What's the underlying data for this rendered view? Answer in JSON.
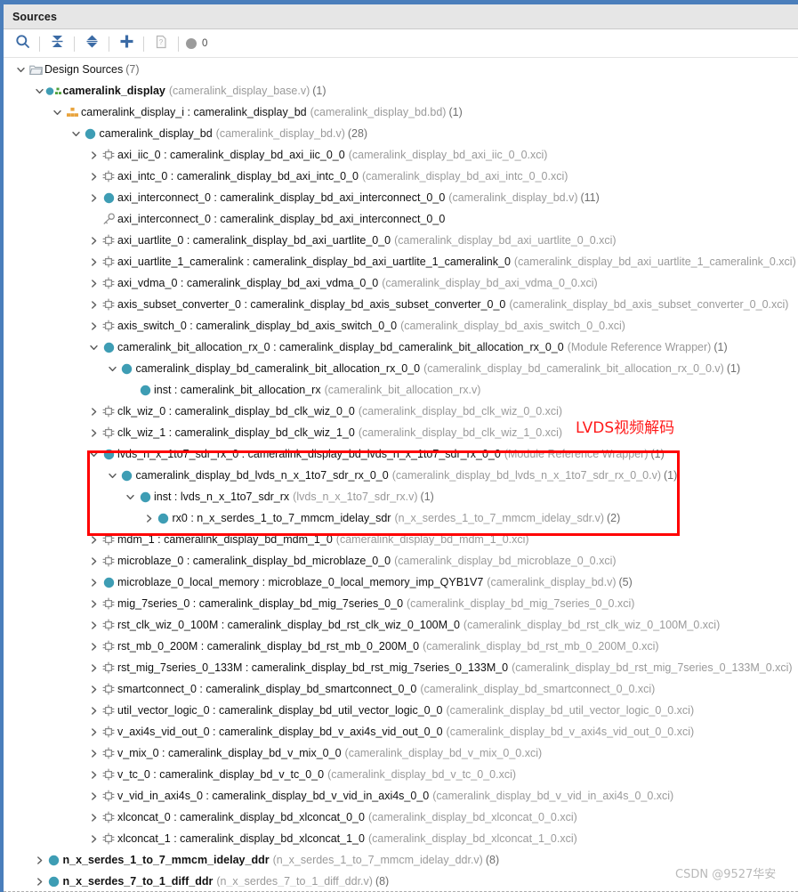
{
  "panel": {
    "title": "Sources"
  },
  "toolbar": {
    "search_tip": "Search",
    "collapse_tip": "Collapse All",
    "expand_tip": "Expand All",
    "add_tip": "Add Sources",
    "report_tip": "Report",
    "count": "0"
  },
  "annotations": {
    "red_note": "LVDS视频解码",
    "watermark": "CSDN @9527华安"
  },
  "tree": [
    {
      "indent": 0,
      "twisty": "down",
      "icon": "folder-icon",
      "name": "Design Sources",
      "bold": false,
      "meta": "",
      "count": "(7)"
    },
    {
      "indent": 1,
      "twisty": "down",
      "icon": "module-green-icon",
      "name": "cameralink_display",
      "bold": true,
      "meta": "(cameralink_display_base.v)",
      "count": "(1)"
    },
    {
      "indent": 2,
      "twisty": "down",
      "icon": "bd-orange-icon",
      "name": "cameralink_display_i : cameralink_display_bd",
      "bold": false,
      "meta": "(cameralink_display_bd.bd)",
      "count": "(1)"
    },
    {
      "indent": 3,
      "twisty": "down",
      "icon": "teal-dot-icon",
      "name": "cameralink_display_bd",
      "bold": false,
      "meta": "(cameralink_display_bd.v)",
      "count": "(28)"
    },
    {
      "indent": 4,
      "twisty": "right",
      "icon": "ip-core-icon",
      "name": "axi_iic_0 : cameralink_display_bd_axi_iic_0_0",
      "bold": false,
      "meta": "(cameralink_display_bd_axi_iic_0_0.xci)",
      "count": ""
    },
    {
      "indent": 4,
      "twisty": "right",
      "icon": "ip-core-icon",
      "name": "axi_intc_0 : cameralink_display_bd_axi_intc_0_0",
      "bold": false,
      "meta": "(cameralink_display_bd_axi_intc_0_0.xci)",
      "count": ""
    },
    {
      "indent": 4,
      "twisty": "right",
      "icon": "teal-dot-icon",
      "name": "axi_interconnect_0 : cameralink_display_bd_axi_interconnect_0_0",
      "bold": false,
      "meta": "(cameralink_display_bd.v)",
      "count": "(11)"
    },
    {
      "indent": 4,
      "twisty": "none",
      "icon": "key-icon",
      "name": "axi_interconnect_0 : cameralink_display_bd_axi_interconnect_0_0",
      "bold": false,
      "meta": "",
      "count": ""
    },
    {
      "indent": 4,
      "twisty": "right",
      "icon": "ip-core-icon",
      "name": "axi_uartlite_0 : cameralink_display_bd_axi_uartlite_0_0",
      "bold": false,
      "meta": "(cameralink_display_bd_axi_uartlite_0_0.xci)",
      "count": ""
    },
    {
      "indent": 4,
      "twisty": "right",
      "icon": "ip-core-icon",
      "name": "axi_uartlite_1_cameralink : cameralink_display_bd_axi_uartlite_1_cameralink_0",
      "bold": false,
      "meta": "(cameralink_display_bd_axi_uartlite_1_cameralink_0.xci)",
      "count": ""
    },
    {
      "indent": 4,
      "twisty": "right",
      "icon": "ip-core-icon",
      "name": "axi_vdma_0 : cameralink_display_bd_axi_vdma_0_0",
      "bold": false,
      "meta": "(cameralink_display_bd_axi_vdma_0_0.xci)",
      "count": ""
    },
    {
      "indent": 4,
      "twisty": "right",
      "icon": "ip-core-icon",
      "name": "axis_subset_converter_0 : cameralink_display_bd_axis_subset_converter_0_0",
      "bold": false,
      "meta": "(cameralink_display_bd_axis_subset_converter_0_0.xci)",
      "count": ""
    },
    {
      "indent": 4,
      "twisty": "right",
      "icon": "ip-core-icon",
      "name": "axis_switch_0 : cameralink_display_bd_axis_switch_0_0",
      "bold": false,
      "meta": "(cameralink_display_bd_axis_switch_0_0.xci)",
      "count": ""
    },
    {
      "indent": 4,
      "twisty": "down",
      "icon": "teal-dot-icon",
      "name": "cameralink_bit_allocation_rx_0 : cameralink_display_bd_cameralink_bit_allocation_rx_0_0",
      "bold": false,
      "meta": "(Module Reference Wrapper)",
      "count": "(1)"
    },
    {
      "indent": 5,
      "twisty": "down",
      "icon": "teal-dot-icon",
      "name": "cameralink_display_bd_cameralink_bit_allocation_rx_0_0",
      "bold": false,
      "meta": "(cameralink_display_bd_cameralink_bit_allocation_rx_0_0.v)",
      "count": "(1)"
    },
    {
      "indent": 6,
      "twisty": "none",
      "icon": "teal-dot-icon",
      "name": "inst : cameralink_bit_allocation_rx",
      "bold": false,
      "meta": "(cameralink_bit_allocation_rx.v)",
      "count": ""
    },
    {
      "indent": 4,
      "twisty": "right",
      "icon": "ip-core-icon",
      "name": "clk_wiz_0 : cameralink_display_bd_clk_wiz_0_0",
      "bold": false,
      "meta": "(cameralink_display_bd_clk_wiz_0_0.xci)",
      "count": ""
    },
    {
      "indent": 4,
      "twisty": "right",
      "icon": "ip-core-icon",
      "name": "clk_wiz_1 : cameralink_display_bd_clk_wiz_1_0",
      "bold": false,
      "meta": "(cameralink_display_bd_clk_wiz_1_0.xci)",
      "count": ""
    },
    {
      "indent": 4,
      "twisty": "down",
      "icon": "teal-dot-icon",
      "name": "lvds_n_x_1to7_sdr_rx_0 : cameralink_display_bd_lvds_n_x_1to7_sdr_rx_0_0",
      "bold": false,
      "meta": "(Module Reference Wrapper)",
      "count": "(1)"
    },
    {
      "indent": 5,
      "twisty": "down",
      "icon": "teal-dot-icon",
      "name": "cameralink_display_bd_lvds_n_x_1to7_sdr_rx_0_0",
      "bold": false,
      "meta": "(cameralink_display_bd_lvds_n_x_1to7_sdr_rx_0_0.v)",
      "count": "(1)"
    },
    {
      "indent": 6,
      "twisty": "down",
      "icon": "teal-dot-icon",
      "name": "inst : lvds_n_x_1to7_sdr_rx",
      "bold": false,
      "meta": "(lvds_n_x_1to7_sdr_rx.v)",
      "count": "(1)"
    },
    {
      "indent": 7,
      "twisty": "right",
      "icon": "teal-dot-icon",
      "name": "rx0 : n_x_serdes_1_to_7_mmcm_idelay_sdr",
      "bold": false,
      "meta": "(n_x_serdes_1_to_7_mmcm_idelay_sdr.v)",
      "count": "(2)"
    },
    {
      "indent": 4,
      "twisty": "right",
      "icon": "ip-core-icon",
      "name": "mdm_1 : cameralink_display_bd_mdm_1_0",
      "bold": false,
      "meta": "(cameralink_display_bd_mdm_1_0.xci)",
      "count": ""
    },
    {
      "indent": 4,
      "twisty": "right",
      "icon": "ip-core-icon",
      "name": "microblaze_0 : cameralink_display_bd_microblaze_0_0",
      "bold": false,
      "meta": "(cameralink_display_bd_microblaze_0_0.xci)",
      "count": ""
    },
    {
      "indent": 4,
      "twisty": "right",
      "icon": "teal-dot-icon",
      "name": "microblaze_0_local_memory : microblaze_0_local_memory_imp_QYB1V7",
      "bold": false,
      "meta": "(cameralink_display_bd.v)",
      "count": "(5)"
    },
    {
      "indent": 4,
      "twisty": "right",
      "icon": "ip-core-icon",
      "name": "mig_7series_0 : cameralink_display_bd_mig_7series_0_0",
      "bold": false,
      "meta": "(cameralink_display_bd_mig_7series_0_0.xci)",
      "count": ""
    },
    {
      "indent": 4,
      "twisty": "right",
      "icon": "ip-core-icon",
      "name": "rst_clk_wiz_0_100M : cameralink_display_bd_rst_clk_wiz_0_100M_0",
      "bold": false,
      "meta": "(cameralink_display_bd_rst_clk_wiz_0_100M_0.xci)",
      "count": ""
    },
    {
      "indent": 4,
      "twisty": "right",
      "icon": "ip-core-icon",
      "name": "rst_mb_0_200M : cameralink_display_bd_rst_mb_0_200M_0",
      "bold": false,
      "meta": "(cameralink_display_bd_rst_mb_0_200M_0.xci)",
      "count": ""
    },
    {
      "indent": 4,
      "twisty": "right",
      "icon": "ip-core-icon",
      "name": "rst_mig_7series_0_133M : cameralink_display_bd_rst_mig_7series_0_133M_0",
      "bold": false,
      "meta": "(cameralink_display_bd_rst_mig_7series_0_133M_0.xci)",
      "count": ""
    },
    {
      "indent": 4,
      "twisty": "right",
      "icon": "ip-core-icon",
      "name": "smartconnect_0 : cameralink_display_bd_smartconnect_0_0",
      "bold": false,
      "meta": "(cameralink_display_bd_smartconnect_0_0.xci)",
      "count": ""
    },
    {
      "indent": 4,
      "twisty": "right",
      "icon": "ip-core-icon",
      "name": "util_vector_logic_0 : cameralink_display_bd_util_vector_logic_0_0",
      "bold": false,
      "meta": "(cameralink_display_bd_util_vector_logic_0_0.xci)",
      "count": ""
    },
    {
      "indent": 4,
      "twisty": "right",
      "icon": "ip-core-icon",
      "name": "v_axi4s_vid_out_0 : cameralink_display_bd_v_axi4s_vid_out_0_0",
      "bold": false,
      "meta": "(cameralink_display_bd_v_axi4s_vid_out_0_0.xci)",
      "count": ""
    },
    {
      "indent": 4,
      "twisty": "right",
      "icon": "ip-core-icon",
      "name": "v_mix_0 : cameralink_display_bd_v_mix_0_0",
      "bold": false,
      "meta": "(cameralink_display_bd_v_mix_0_0.xci)",
      "count": ""
    },
    {
      "indent": 4,
      "twisty": "right",
      "icon": "ip-core-icon",
      "name": "v_tc_0 : cameralink_display_bd_v_tc_0_0",
      "bold": false,
      "meta": "(cameralink_display_bd_v_tc_0_0.xci)",
      "count": ""
    },
    {
      "indent": 4,
      "twisty": "right",
      "icon": "ip-core-icon",
      "name": "v_vid_in_axi4s_0 : cameralink_display_bd_v_vid_in_axi4s_0_0",
      "bold": false,
      "meta": "(cameralink_display_bd_v_vid_in_axi4s_0_0.xci)",
      "count": ""
    },
    {
      "indent": 4,
      "twisty": "right",
      "icon": "ip-core-icon",
      "name": "xlconcat_0 : cameralink_display_bd_xlconcat_0_0",
      "bold": false,
      "meta": "(cameralink_display_bd_xlconcat_0_0.xci)",
      "count": ""
    },
    {
      "indent": 4,
      "twisty": "right",
      "icon": "ip-core-icon",
      "name": "xlconcat_1 : cameralink_display_bd_xlconcat_1_0",
      "bold": false,
      "meta": "(cameralink_display_bd_xlconcat_1_0.xci)",
      "count": ""
    },
    {
      "indent": 1,
      "twisty": "right",
      "icon": "teal-dot-icon",
      "name": "n_x_serdes_1_to_7_mmcm_idelay_ddr",
      "bold": true,
      "meta": "(n_x_serdes_1_to_7_mmcm_idelay_ddr.v)",
      "count": "(8)"
    },
    {
      "indent": 1,
      "twisty": "right",
      "icon": "teal-dot-icon",
      "name": "n_x_serdes_7_to_1_diff_ddr",
      "bold": true,
      "meta": "(n_x_serdes_7_to_1_diff_ddr.v)",
      "count": "(8)"
    }
  ]
}
